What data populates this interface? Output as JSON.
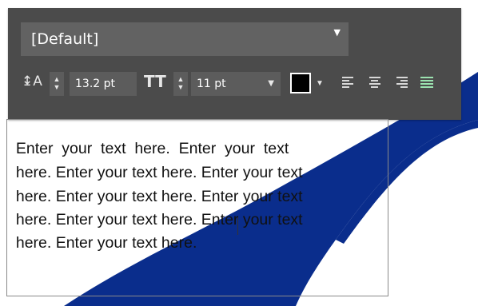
{
  "toolbar": {
    "style_value": "[Default]",
    "line_spacing_value": "13.2 pt",
    "font_size_value": "11 pt",
    "text_color": "#000000",
    "accent_active_align": "#9be2b0",
    "icons": {
      "line_spacing": "line-spacing-icon",
      "font_size": "font-size-icon",
      "align_left": "align-left-icon",
      "align_center": "align-center-icon",
      "align_right": "align-right-icon",
      "align_justify": "align-justify-icon"
    }
  },
  "textbox": {
    "lines": [
      "Enter  your  text  here.  Enter  your  text",
      "here. Enter your text here. Enter your text",
      "here. Enter your text here. Enter your text",
      "here. Enter your text here. Enter your text",
      "here. Enter your text here."
    ]
  },
  "colors": {
    "toolbar_bg": "#4b4b4b",
    "field_bg": "#5c5c5c",
    "shape_blue": "#0a2d8c",
    "squiggle": "#e0201c"
  }
}
